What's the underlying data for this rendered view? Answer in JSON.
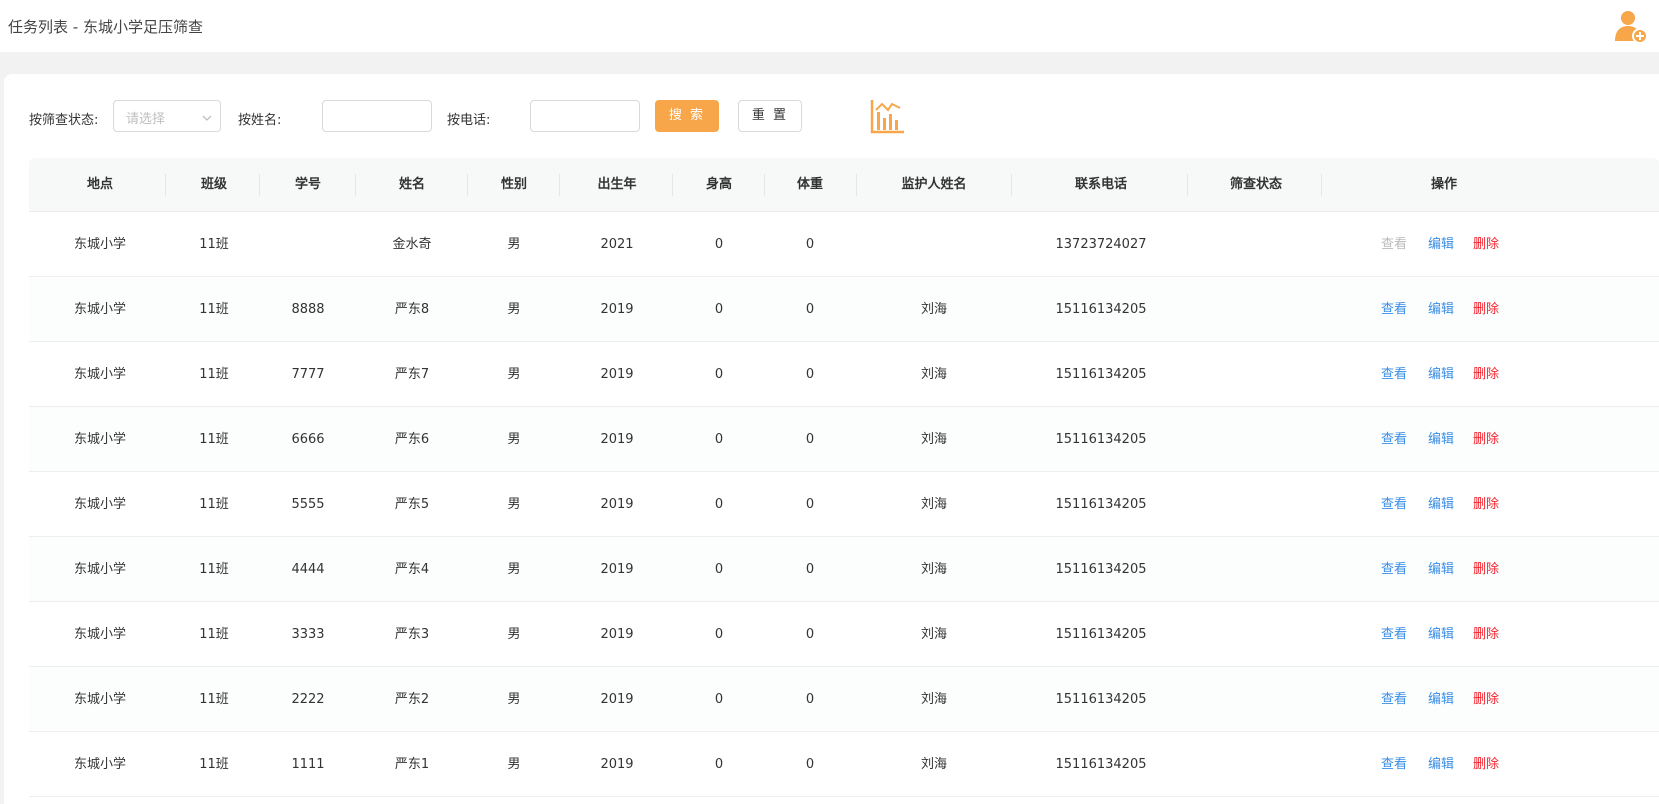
{
  "title": "任务列表 - 东城小学足压筛查",
  "filters": {
    "status_label": "按筛查状态:",
    "status_placeholder": "请选择",
    "name_label": "按姓名:",
    "phone_label": "按电话:",
    "search_btn": "搜 索",
    "reset_btn": "重 置"
  },
  "colors": {
    "accent": "#f7a64a",
    "link": "#3a8ee6",
    "danger": "#f5222d"
  },
  "columns": [
    "地点",
    "班级",
    "学号",
    "姓名",
    "性别",
    "出生年",
    "身高",
    "体重",
    "监护人姓名",
    "联系电话",
    "筛查状态",
    "操作"
  ],
  "actions": {
    "view": "查看",
    "edit": "编辑",
    "delete": "删除"
  },
  "rows": [
    [
      "东城小学",
      "11班",
      "",
      "金水奇",
      "男",
      "2021",
      "0",
      "0",
      "",
      "13723724027",
      ""
    ],
    [
      "东城小学",
      "11班",
      "8888",
      "严东8",
      "男",
      "2019",
      "0",
      "0",
      "刘海",
      "15116134205",
      ""
    ],
    [
      "东城小学",
      "11班",
      "7777",
      "严东7",
      "男",
      "2019",
      "0",
      "0",
      "刘海",
      "15116134205",
      ""
    ],
    [
      "东城小学",
      "11班",
      "6666",
      "严东6",
      "男",
      "2019",
      "0",
      "0",
      "刘海",
      "15116134205",
      ""
    ],
    [
      "东城小学",
      "11班",
      "5555",
      "严东5",
      "男",
      "2019",
      "0",
      "0",
      "刘海",
      "15116134205",
      ""
    ],
    [
      "东城小学",
      "11班",
      "4444",
      "严东4",
      "男",
      "2019",
      "0",
      "0",
      "刘海",
      "15116134205",
      ""
    ],
    [
      "东城小学",
      "11班",
      "3333",
      "严东3",
      "男",
      "2019",
      "0",
      "0",
      "刘海",
      "15116134205",
      ""
    ],
    [
      "东城小学",
      "11班",
      "2222",
      "严东2",
      "男",
      "2019",
      "0",
      "0",
      "刘海",
      "15116134205",
      ""
    ],
    [
      "东城小学",
      "11班",
      "1111",
      "严东1",
      "男",
      "2019",
      "0",
      "0",
      "刘海",
      "15116134205",
      ""
    ]
  ],
  "view_disabled": [
    true,
    false,
    false,
    false,
    false,
    false,
    false,
    false,
    false
  ]
}
